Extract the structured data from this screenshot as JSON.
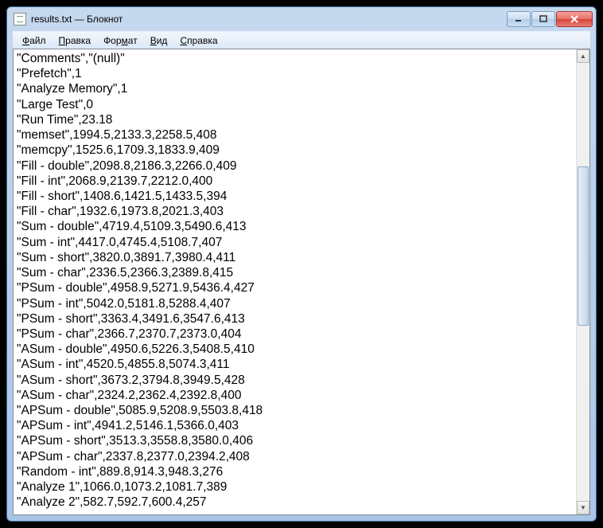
{
  "window": {
    "title": "results.txt — Блокнот"
  },
  "menu": {
    "file": "Файл",
    "edit": "Правка",
    "format": "Формат",
    "view": "Вид",
    "help": "Справка"
  },
  "content_lines": [
    "\"Comments\",\"(null)\"",
    "\"Prefetch\",1",
    "\"Analyze Memory\",1",
    "\"Large Test\",0",
    "\"Run Time\",23.18",
    "\"memset\",1994.5,2133.3,2258.5,408",
    "\"memcpy\",1525.6,1709.3,1833.9,409",
    "\"Fill - double\",2098.8,2186.3,2266.0,409",
    "\"Fill - int\",2068.9,2139.7,2212.0,400",
    "\"Fill - short\",1408.6,1421.5,1433.5,394",
    "\"Fill - char\",1932.6,1973.8,2021.3,403",
    "\"Sum - double\",4719.4,5109.3,5490.6,413",
    "\"Sum - int\",4417.0,4745.4,5108.7,407",
    "\"Sum - short\",3820.0,3891.7,3980.4,411",
    "\"Sum - char\",2336.5,2366.3,2389.8,415",
    "\"PSum - double\",4958.9,5271.9,5436.4,427",
    "\"PSum - int\",5042.0,5181.8,5288.4,407",
    "\"PSum - short\",3363.4,3491.6,3547.6,413",
    "\"PSum - char\",2366.7,2370.7,2373.0,404",
    "\"ASum - double\",4950.6,5226.3,5408.5,410",
    "\"ASum - int\",4520.5,4855.8,5074.3,411",
    "\"ASum - short\",3673.2,3794.8,3949.5,428",
    "\"ASum - char\",2324.2,2362.4,2392.8,400",
    "\"APSum - double\",5085.9,5208.9,5503.8,418",
    "\"APSum - int\",4941.2,5146.1,5366.0,403",
    "\"APSum - short\",3513.3,3558.8,3580.0,406",
    "\"APSum - char\",2337.8,2377.0,2394.2,408",
    "\"Random - int\",889.8,914.3,948.3,276",
    "\"Analyze 1\",1066.0,1073.2,1081.7,389",
    "\"Analyze 2\",582.7,592.7,600.4,257"
  ]
}
